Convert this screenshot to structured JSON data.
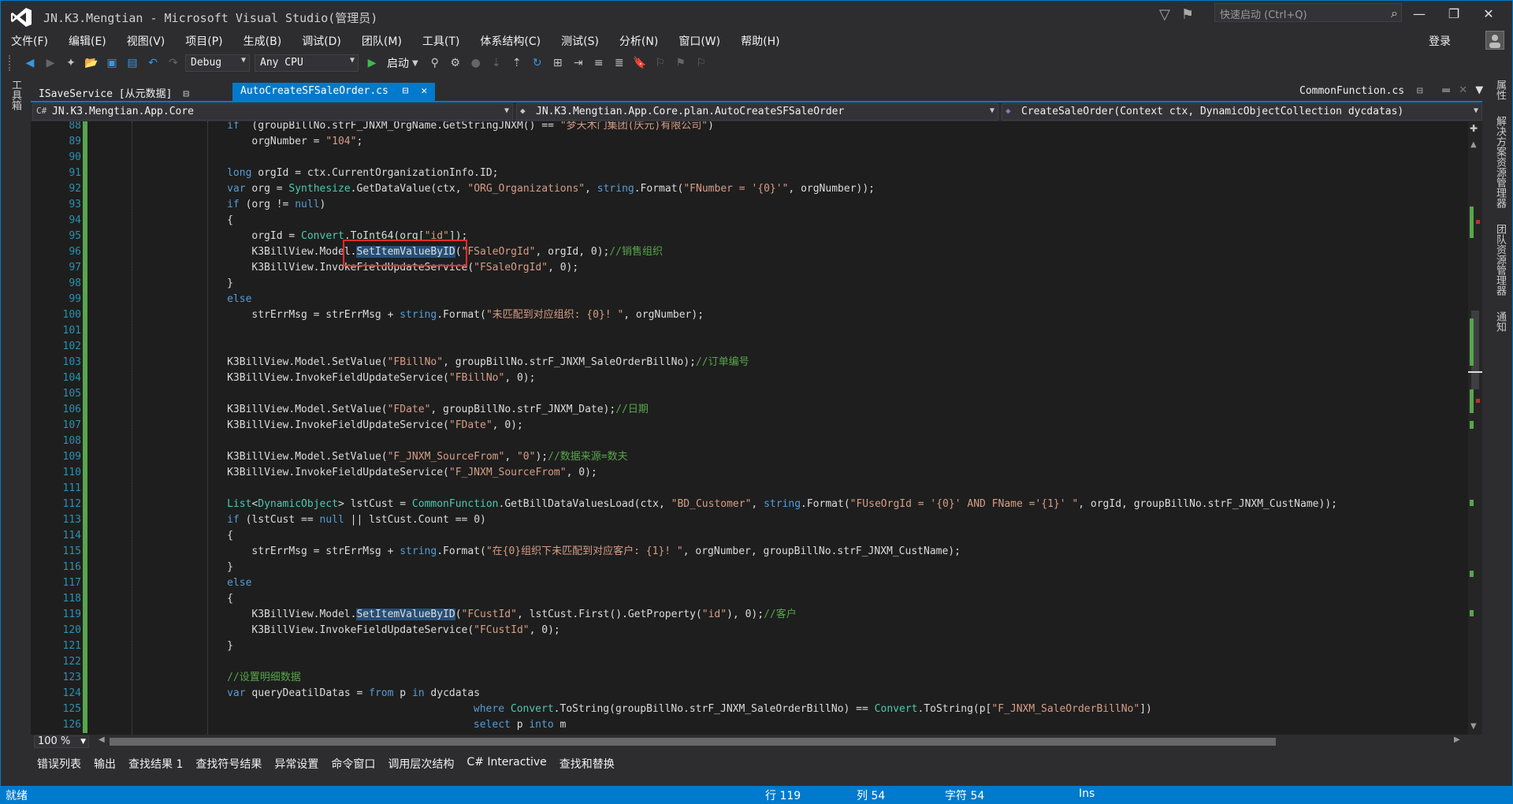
{
  "window": {
    "title": "JN.K3.Mengtian - Microsoft Visual Studio(管理员)",
    "quick_launch_placeholder": "快速启动 (Ctrl+Q)",
    "minimize": "—",
    "restore": "❐",
    "close": "✕"
  },
  "menu": {
    "items": [
      "文件(F)",
      "编辑(E)",
      "视图(V)",
      "项目(P)",
      "生成(B)",
      "调试(D)",
      "团队(M)",
      "工具(T)",
      "体系结构(C)",
      "测试(S)",
      "分析(N)",
      "窗口(W)",
      "帮助(H)"
    ],
    "login": "登录"
  },
  "toolbar": {
    "config": "Debug",
    "platform": "Any CPU",
    "start_label": "启动"
  },
  "left_strip": {
    "label": "工具箱"
  },
  "right_strip": {
    "items": [
      "属性",
      "解决方案资源管理器",
      "团队资源管理器",
      "通知"
    ]
  },
  "tabs": {
    "items": [
      {
        "label": "ISaveService [从元数据]"
      },
      {
        "label": "AutoCreateSFSaleOrder.cs"
      }
    ],
    "right_tab": "CommonFunction.cs"
  },
  "navbar": {
    "project": "JN.K3.Mengtian.App.Core",
    "class": "JN.K3.Mengtian.App.Core.plan.AutoCreateSFSaleOrder",
    "member": "CreateSaleOrder(Context ctx, DynamicObjectCollection dycdatas)"
  },
  "editor": {
    "lines": [
      {
        "n": "88",
        "indent": 8,
        "parts": [
          [
            "kw",
            "if"
          ],
          [
            "",
            "  (groupBillNo.strF_JNXM_OrgName.GetStringJNXM() == "
          ],
          [
            "str",
            "\"梦天木门集团(庆元)有限公司\""
          ],
          [
            "",
            ")"
          ]
        ]
      },
      {
        "n": "89",
        "indent": 10,
        "parts": [
          [
            "",
            "orgNumber = "
          ],
          [
            "str",
            "\"104\""
          ],
          [
            "",
            ";"
          ]
        ]
      },
      {
        "n": "90",
        "indent": 0,
        "parts": []
      },
      {
        "n": "91",
        "indent": 8,
        "parts": [
          [
            "kw",
            "long"
          ],
          [
            "",
            " orgId = ctx.CurrentOrganizationInfo.ID;"
          ]
        ]
      },
      {
        "n": "92",
        "indent": 8,
        "parts": [
          [
            "kw",
            "var"
          ],
          [
            "",
            " org = "
          ],
          [
            "ty",
            "Synthesize"
          ],
          [
            "",
            ".GetDataValue(ctx, "
          ],
          [
            "str",
            "\"ORG_Organizations\""
          ],
          [
            "",
            ", "
          ],
          [
            "kw",
            "string"
          ],
          [
            "",
            ".Format("
          ],
          [
            "str",
            "\"FNumber = '{0}'\""
          ],
          [
            "",
            ", orgNumber));"
          ]
        ]
      },
      {
        "n": "93",
        "indent": 8,
        "parts": [
          [
            "kw",
            "if"
          ],
          [
            "",
            " (org != "
          ],
          [
            "kw",
            "null"
          ],
          [
            "",
            ")"
          ]
        ]
      },
      {
        "n": "94",
        "indent": 8,
        "parts": [
          [
            "",
            "{"
          ]
        ]
      },
      {
        "n": "95",
        "indent": 10,
        "parts": [
          [
            "",
            "orgId = "
          ],
          [
            "ty",
            "Convert"
          ],
          [
            "",
            ".ToInt64(org["
          ],
          [
            "str",
            "\"id\""
          ],
          [
            "",
            "]);"
          ]
        ]
      },
      {
        "n": "96",
        "indent": 10,
        "parts": [
          [
            "",
            "K3BillView.Model."
          ],
          [
            "hl",
            "SetItemValueByID"
          ],
          [
            "",
            "("
          ],
          [
            "str",
            "\"FSaleOrgId\""
          ],
          [
            "",
            ", orgId, 0);"
          ],
          [
            "cm",
            "//销售组织"
          ]
        ]
      },
      {
        "n": "97",
        "indent": 10,
        "parts": [
          [
            "",
            "K3BillView.InvokeFieldUpdateService("
          ],
          [
            "str",
            "\"FSaleOrgId\""
          ],
          [
            "",
            ", 0);"
          ]
        ]
      },
      {
        "n": "98",
        "indent": 8,
        "parts": [
          [
            "",
            "}"
          ]
        ]
      },
      {
        "n": "99",
        "indent": 8,
        "parts": [
          [
            "kw",
            "else"
          ]
        ]
      },
      {
        "n": "100",
        "indent": 10,
        "parts": [
          [
            "",
            "strErrMsg = strErrMsg + "
          ],
          [
            "kw",
            "string"
          ],
          [
            "",
            ".Format("
          ],
          [
            "str",
            "\"未匹配到对应组织: {0}! \""
          ],
          [
            "",
            ", orgNumber);"
          ]
        ]
      },
      {
        "n": "101",
        "indent": 0,
        "parts": []
      },
      {
        "n": "102",
        "indent": 0,
        "parts": []
      },
      {
        "n": "103",
        "indent": 8,
        "parts": [
          [
            "",
            "K3BillView.Model.SetValue("
          ],
          [
            "str",
            "\"FBillNo\""
          ],
          [
            "",
            ", groupBillNo.strF_JNXM_SaleOrderBillNo);"
          ],
          [
            "cm",
            "//订单编号"
          ]
        ]
      },
      {
        "n": "104",
        "indent": 8,
        "parts": [
          [
            "",
            "K3BillView.InvokeFieldUpdateService("
          ],
          [
            "str",
            "\"FBillNo\""
          ],
          [
            "",
            ", 0);"
          ]
        ]
      },
      {
        "n": "105",
        "indent": 0,
        "parts": []
      },
      {
        "n": "106",
        "indent": 8,
        "parts": [
          [
            "",
            "K3BillView.Model.SetValue("
          ],
          [
            "str",
            "\"FDate\""
          ],
          [
            "",
            ", groupBillNo.strF_JNXM_Date);"
          ],
          [
            "cm",
            "//日期"
          ]
        ]
      },
      {
        "n": "107",
        "indent": 8,
        "parts": [
          [
            "",
            "K3BillView.InvokeFieldUpdateService("
          ],
          [
            "str",
            "\"FDate\""
          ],
          [
            "",
            ", 0);"
          ]
        ]
      },
      {
        "n": "108",
        "indent": 0,
        "parts": []
      },
      {
        "n": "109",
        "indent": 8,
        "parts": [
          [
            "",
            "K3BillView.Model.SetValue("
          ],
          [
            "str",
            "\"F_JNXM_SourceFrom\""
          ],
          [
            "",
            ", "
          ],
          [
            "str",
            "\"0\""
          ],
          [
            "",
            ");"
          ],
          [
            "cm",
            "//数据来源=数夫"
          ]
        ]
      },
      {
        "n": "110",
        "indent": 8,
        "parts": [
          [
            "",
            "K3BillView.InvokeFieldUpdateService("
          ],
          [
            "str",
            "\"F_JNXM_SourceFrom\""
          ],
          [
            "",
            ", 0);"
          ]
        ]
      },
      {
        "n": "111",
        "indent": 0,
        "parts": []
      },
      {
        "n": "112",
        "indent": 8,
        "parts": [
          [
            "ty",
            "List"
          ],
          [
            "",
            "<"
          ],
          [
            "ty",
            "DynamicObject"
          ],
          [
            "",
            "> lstCust = "
          ],
          [
            "ty",
            "CommonFunction"
          ],
          [
            "",
            ".GetBillDataValuesLoad(ctx, "
          ],
          [
            "str",
            "\"BD_Customer\""
          ],
          [
            "",
            ", "
          ],
          [
            "kw",
            "string"
          ],
          [
            "",
            ".Format("
          ],
          [
            "str",
            "\"FUseOrgId = '{0}' AND FName ='{1}' \""
          ],
          [
            "",
            ", orgId, groupBillNo.strF_JNXM_CustName));"
          ]
        ]
      },
      {
        "n": "113",
        "indent": 8,
        "parts": [
          [
            "kw",
            "if"
          ],
          [
            "",
            " (lstCust == "
          ],
          [
            "kw",
            "null"
          ],
          [
            "",
            " || lstCust.Count == 0)"
          ]
        ]
      },
      {
        "n": "114",
        "indent": 8,
        "parts": [
          [
            "",
            "{"
          ]
        ]
      },
      {
        "n": "115",
        "indent": 10,
        "parts": [
          [
            "",
            "strErrMsg = strErrMsg + "
          ],
          [
            "kw",
            "string"
          ],
          [
            "",
            ".Format("
          ],
          [
            "str",
            "\"在{0}组织下未匹配到对应客户: {1}! \""
          ],
          [
            "",
            ", orgNumber, groupBillNo.strF_JNXM_CustName);"
          ]
        ]
      },
      {
        "n": "116",
        "indent": 8,
        "parts": [
          [
            "",
            "}"
          ]
        ]
      },
      {
        "n": "117",
        "indent": 8,
        "parts": [
          [
            "kw",
            "else"
          ]
        ]
      },
      {
        "n": "118",
        "indent": 8,
        "parts": [
          [
            "",
            "{"
          ]
        ]
      },
      {
        "n": "119",
        "indent": 10,
        "parts": [
          [
            "",
            "K3BillView.Model."
          ],
          [
            "hl",
            "SetItemValueByID"
          ],
          [
            "",
            "("
          ],
          [
            "str",
            "\"FCustId\""
          ],
          [
            "",
            ", lstCust.First().GetProperty("
          ],
          [
            "str",
            "\"id\""
          ],
          [
            "",
            "), 0);"
          ],
          [
            "cm",
            "//客户"
          ]
        ]
      },
      {
        "n": "120",
        "indent": 10,
        "parts": [
          [
            "",
            "K3BillView.InvokeFieldUpdateService("
          ],
          [
            "str",
            "\"FCustId\""
          ],
          [
            "",
            ", 0);"
          ]
        ]
      },
      {
        "n": "121",
        "indent": 8,
        "parts": [
          [
            "",
            "}"
          ]
        ]
      },
      {
        "n": "122",
        "indent": 0,
        "parts": []
      },
      {
        "n": "123",
        "indent": 8,
        "parts": [
          [
            "cm",
            "//设置明细数据"
          ]
        ]
      },
      {
        "n": "124",
        "indent": 8,
        "parts": [
          [
            "kw",
            "var"
          ],
          [
            "",
            " queryDeatilDatas = "
          ],
          [
            "kw",
            "from"
          ],
          [
            "",
            " p "
          ],
          [
            "kw",
            "in"
          ],
          [
            "",
            " dycdatas"
          ]
        ]
      },
      {
        "n": "125",
        "indent": 28,
        "parts": [
          [
            "kw",
            "where"
          ],
          [
            "",
            " "
          ],
          [
            "ty",
            "Convert"
          ],
          [
            "",
            ".ToString(groupBillNo.strF_JNXM_SaleOrderBillNo) == "
          ],
          [
            "ty",
            "Convert"
          ],
          [
            "",
            ".ToString(p["
          ],
          [
            "str",
            "\"F_JNXM_SaleOrderBillNo\""
          ],
          [
            "",
            "])"
          ]
        ]
      },
      {
        "n": "126",
        "indent": 28,
        "parts": [
          [
            "kw",
            "select"
          ],
          [
            "",
            " p "
          ],
          [
            "kw",
            "into"
          ],
          [
            "",
            " m"
          ]
        ]
      }
    ],
    "changed_lines": [
      "88",
      "89",
      "90",
      "91",
      "92",
      "93",
      "94",
      "95",
      "96",
      "97",
      "98",
      "99",
      "100",
      "101",
      "102",
      "103",
      "104",
      "105",
      "106",
      "107",
      "108",
      "109",
      "110",
      "111",
      "112",
      "113",
      "114",
      "115",
      "116",
      "117",
      "118",
      "119",
      "120",
      "121",
      "122",
      "123",
      "124",
      "125",
      "126"
    ]
  },
  "zoom": "100 %",
  "bottom_tabs": [
    "错误列表",
    "输出",
    "查找结果 1",
    "查找符号结果",
    "异常设置",
    "命令窗口",
    "调用层次结构",
    "C# Interactive",
    "查找和替换"
  ],
  "status": {
    "ready": "就绪",
    "row": "行 119",
    "col": "列 54",
    "char": "字符 54",
    "mode": "Ins"
  },
  "colors": {
    "accent": "#007acc",
    "keyword": "#569cd6",
    "string": "#d69d85",
    "comment": "#57a64a",
    "type": "#4ec9b0",
    "highlight": "#264f78",
    "callout": "#ff2a2a"
  }
}
